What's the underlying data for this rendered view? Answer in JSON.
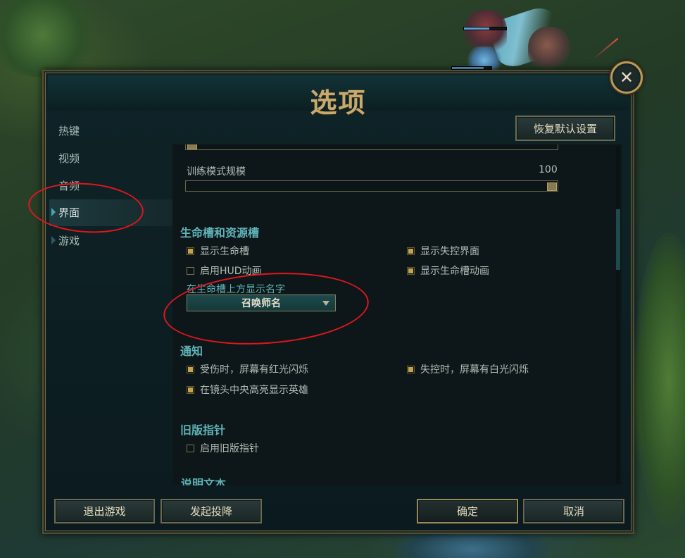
{
  "dialog": {
    "title": "选项",
    "close_symbol": "✕"
  },
  "sidebar": {
    "items": [
      {
        "label": "热键"
      },
      {
        "label": "视频"
      },
      {
        "label": "音频"
      },
      {
        "label": "界面"
      },
      {
        "label": "游戏"
      }
    ],
    "active_index": 3
  },
  "content": {
    "reset_button_label": "恢复默认设置",
    "training_scale": {
      "label": "训练模式规模",
      "value": "100",
      "level": 1.0
    },
    "health_section": {
      "title": "生命槽和资源槽",
      "checkboxes": [
        {
          "label": "显示生命槽",
          "checked": true
        },
        {
          "label": "显示失控界面",
          "checked": true
        },
        {
          "label": "启用HUD动画",
          "checked": false
        },
        {
          "label": "显示生命槽动画",
          "checked": true
        }
      ],
      "name_display_label": "在生命槽上方显示名字",
      "name_display_value": "召唤师名"
    },
    "notify_section": {
      "title": "通知",
      "checkboxes": [
        {
          "label": "受伤时，屏幕有红光闪烁",
          "checked": true
        },
        {
          "label": "失控时，屏幕有白光闪烁",
          "checked": true
        },
        {
          "label": "在镜头中央高亮显示英雄",
          "checked": true
        }
      ]
    },
    "legacy_section": {
      "title": "旧版指针",
      "checkboxes": [
        {
          "label": "启用旧版指针",
          "checked": false
        }
      ]
    },
    "next_section_partial": "说明文本"
  },
  "footer": {
    "exit_label": "退出游戏",
    "surrender_label": "发起投降",
    "ok_label": "确定",
    "cancel_label": "取消"
  },
  "colors": {
    "accent_gold": "#c8aa6e",
    "section_teal": "#5fb3b8",
    "annotation_red": "#e0161d"
  }
}
